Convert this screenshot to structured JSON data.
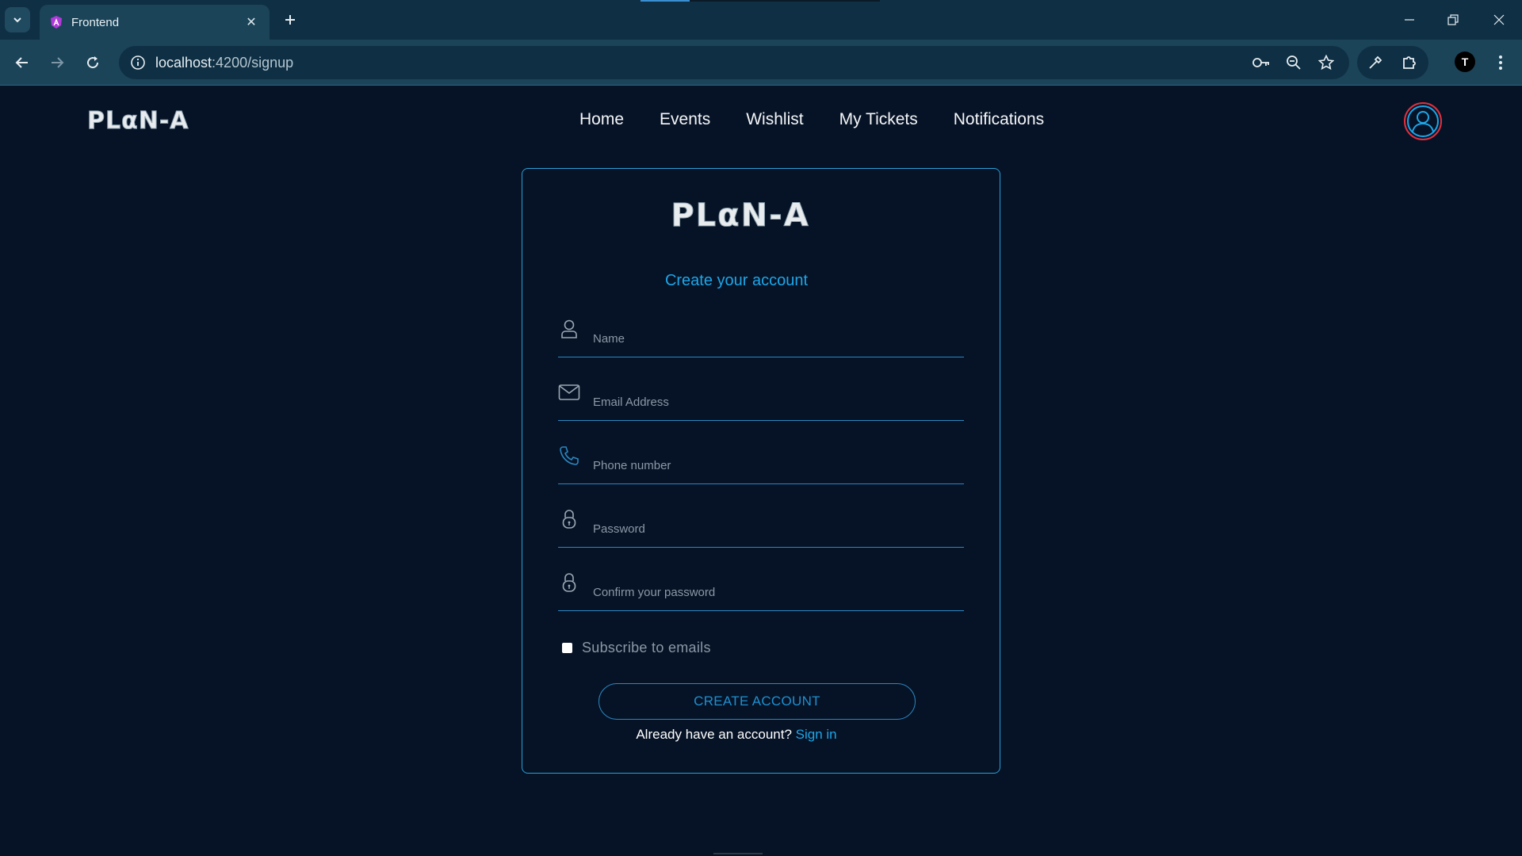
{
  "browser": {
    "tab_title": "Frontend",
    "url_host": "localhost",
    "url_path": ":4200/signup"
  },
  "site": {
    "logo": "PLαN-A",
    "nav": [
      "Home",
      "Events",
      "Wishlist",
      "My Tickets",
      "Notifications"
    ]
  },
  "signup": {
    "logo": "PLαN-A",
    "heading": "Create your account",
    "fields": {
      "name": {
        "placeholder": "Name",
        "value": ""
      },
      "email": {
        "placeholder": "Email Address",
        "value": ""
      },
      "phone": {
        "placeholder": "Phone number",
        "value": ""
      },
      "password": {
        "placeholder": "Password",
        "value": ""
      },
      "confirm": {
        "placeholder": "Confirm your password",
        "value": ""
      }
    },
    "subscribe_label": "Subscribe to emails",
    "create_button": "CREATE ACCOUNT",
    "already_text": "Already have an account?",
    "signin_link": "Sign in"
  },
  "colors": {
    "page_bg": "#061326",
    "accent": "#1ea6e8",
    "avatar_ring": "#e0303e",
    "chrome_bg": "#0f2f44"
  }
}
